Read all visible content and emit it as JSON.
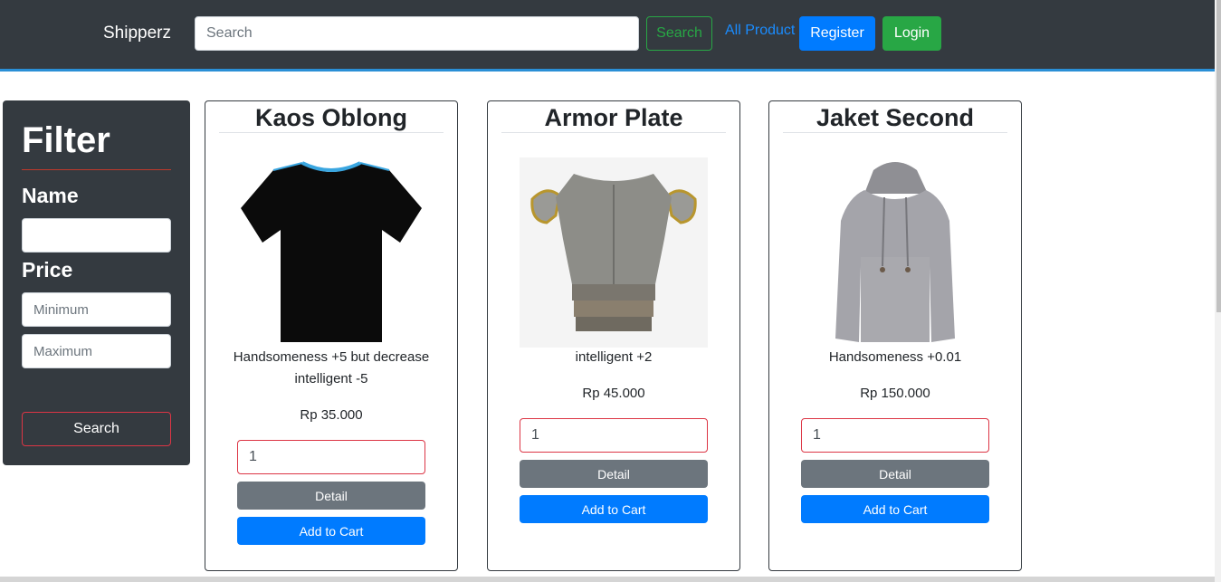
{
  "navbar": {
    "brand": "Shipperz",
    "search_placeholder": "Search",
    "search_button": "Search",
    "all_product_link": "All Product",
    "register_button": "Register",
    "login_button": "Login"
  },
  "filter": {
    "title": "Filter",
    "name_label": "Name",
    "name_value": "",
    "price_label": "Price",
    "min_placeholder": "Minimum",
    "max_placeholder": "Maximum",
    "search_button": "Search"
  },
  "products": [
    {
      "title": "Kaos Oblong",
      "image_icon": "black-tshirt-image",
      "description": "Handsomeness +5 but decrease intelligent -5",
      "price": "Rp 35.000",
      "quantity": "1",
      "detail_button": "Detail",
      "cart_button": "Add to Cart"
    },
    {
      "title": "Armor Plate",
      "image_icon": "armor-plate-image",
      "description": "intelligent +2",
      "price": "Rp 45.000",
      "quantity": "1",
      "detail_button": "Detail",
      "cart_button": "Add to Cart"
    },
    {
      "title": "Jaket Second",
      "image_icon": "grey-hoodie-image",
      "description": "Handsomeness +0.01",
      "price": "Rp 150.000",
      "quantity": "1",
      "detail_button": "Detail",
      "cart_button": "Add to Cart"
    }
  ],
  "colors": {
    "navbar_bg": "#343a40",
    "primary": "#007bff",
    "success": "#28a745",
    "danger": "#dc3545",
    "secondary": "#6c757d"
  }
}
